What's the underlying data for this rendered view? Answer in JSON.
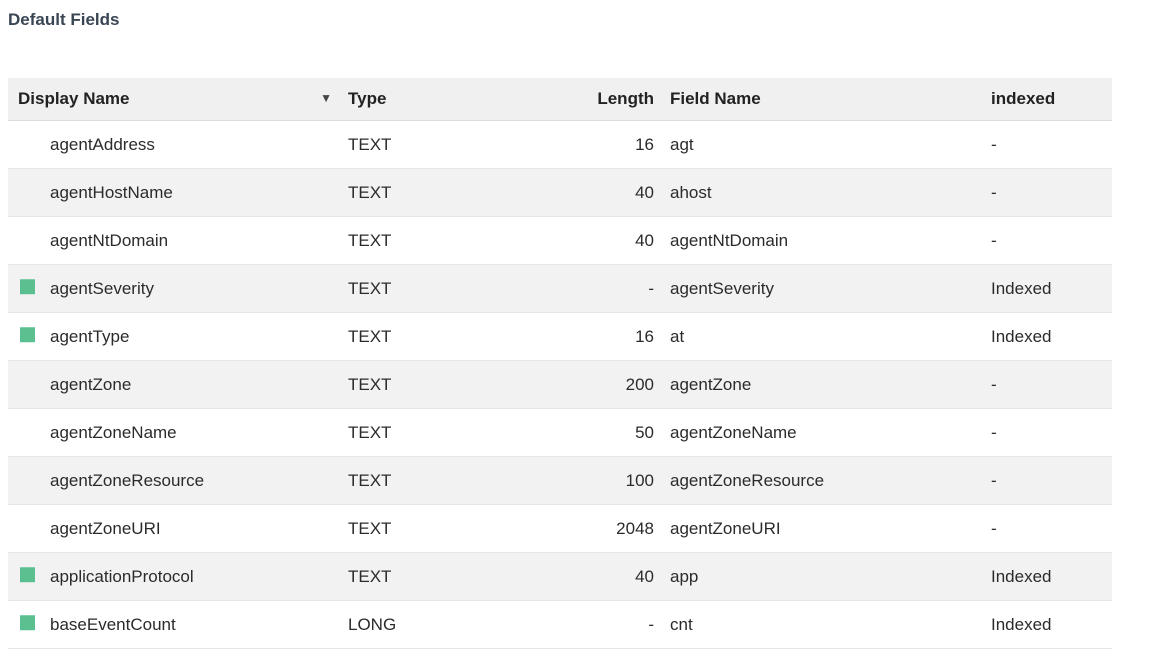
{
  "section": {
    "title": "Default Fields"
  },
  "colors": {
    "indexed_marker": "#5cbf8f",
    "alt_row": "#f2f2f2",
    "header_bg": "#f0f0f0"
  },
  "table": {
    "columns": {
      "display_name": "Display Name",
      "sort_icon": "▼",
      "type": "Type",
      "length": "Length",
      "field_name": "Field Name",
      "indexed": "indexed"
    },
    "rows": [
      {
        "display_name": "agentAddress",
        "type": "TEXT",
        "length": "16",
        "field_name": "agt",
        "indexed": "-",
        "marked": false
      },
      {
        "display_name": "agentHostName",
        "type": "TEXT",
        "length": "40",
        "field_name": "ahost",
        "indexed": "-",
        "marked": false
      },
      {
        "display_name": "agentNtDomain",
        "type": "TEXT",
        "length": "40",
        "field_name": "agentNtDomain",
        "indexed": "-",
        "marked": false
      },
      {
        "display_name": "agentSeverity",
        "type": "TEXT",
        "length": "-",
        "field_name": "agentSeverity",
        "indexed": "Indexed",
        "marked": true
      },
      {
        "display_name": "agentType",
        "type": "TEXT",
        "length": "16",
        "field_name": "at",
        "indexed": "Indexed",
        "marked": true
      },
      {
        "display_name": "agentZone",
        "type": "TEXT",
        "length": "200",
        "field_name": "agentZone",
        "indexed": "-",
        "marked": false
      },
      {
        "display_name": "agentZoneName",
        "type": "TEXT",
        "length": "50",
        "field_name": "agentZoneName",
        "indexed": "-",
        "marked": false
      },
      {
        "display_name": "agentZoneResource",
        "type": "TEXT",
        "length": "100",
        "field_name": "agentZoneResource",
        "indexed": "-",
        "marked": false
      },
      {
        "display_name": "agentZoneURI",
        "type": "TEXT",
        "length": "2048",
        "field_name": "agentZoneURI",
        "indexed": "-",
        "marked": false
      },
      {
        "display_name": "applicationProtocol",
        "type": "TEXT",
        "length": "40",
        "field_name": "app",
        "indexed": "Indexed",
        "marked": true
      },
      {
        "display_name": "baseEventCount",
        "type": "LONG",
        "length": "-",
        "field_name": "cnt",
        "indexed": "Indexed",
        "marked": true
      }
    ]
  }
}
